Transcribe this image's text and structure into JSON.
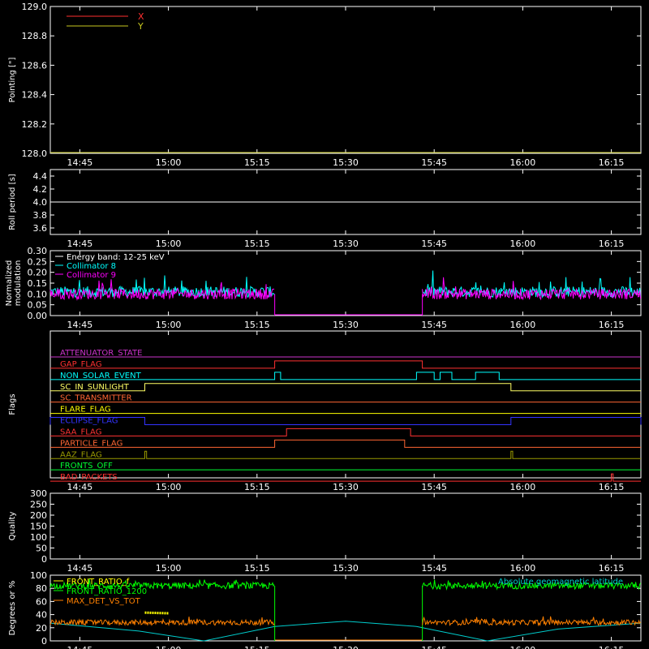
{
  "chart_data": [
    {
      "type": "line",
      "ylabel": "Pointing [\"]",
      "ylim": [
        128.0,
        129.0
      ],
      "yticks": [
        "128.0",
        "128.2",
        "128.4",
        "128.6",
        "128.8",
        "129.0"
      ],
      "xticks": [
        "14:45",
        "15:00",
        "15:15",
        "15:30",
        "15:45",
        "16:00",
        "16:15"
      ],
      "legend": [
        {
          "name": "X",
          "color": "#ff3030"
        },
        {
          "name": "Y",
          "color": "#c8c820"
        }
      ],
      "series": [
        {
          "name": "X",
          "values": []
        },
        {
          "name": "Y",
          "values": [
            {
              "x": "14:40",
              "y": 128.0
            },
            {
              "x": "16:20",
              "y": 128.0
            }
          ]
        }
      ]
    },
    {
      "type": "line",
      "ylabel": "Roll period [s]",
      "ylim": [
        3.5,
        4.5
      ],
      "yticks": [
        "3.6",
        "3.8",
        "4.0",
        "4.2",
        "4.4"
      ],
      "xticks": [
        "14:45",
        "15:00",
        "15:15",
        "15:30",
        "15:45",
        "16:00",
        "16:15"
      ],
      "series": [
        {
          "name": "roll",
          "values": [
            {
              "x": "14:40",
              "y": 4.0
            },
            {
              "x": "16:20",
              "y": 4.0
            }
          ]
        }
      ]
    },
    {
      "type": "line",
      "ylabel": "Normalized\nmodulation",
      "ylim": [
        0.0,
        0.3
      ],
      "yticks": [
        "0.00",
        "0.05",
        "0.10",
        "0.15",
        "0.20",
        "0.25",
        "0.30"
      ],
      "xticks": [
        "14:45",
        "15:00",
        "15:15",
        "15:30",
        "15:45",
        "16:00",
        "16:15"
      ],
      "legend": [
        {
          "name": "Energy band: 12-25 keV",
          "color": "#ffffff"
        },
        {
          "name": "Collimator 8",
          "color": "#00ffff"
        },
        {
          "name": "Collimator 9",
          "color": "#ff00ff"
        }
      ],
      "series": [
        {
          "name": "Collimator 8",
          "mean": 0.11,
          "segments": [
            [
              "14:40",
              "15:18"
            ],
            [
              "15:43",
              "16:20"
            ]
          ]
        },
        {
          "name": "Collimator 9",
          "mean": 0.1,
          "segments": [
            [
              "14:40",
              "15:18"
            ],
            [
              "15:43",
              "16:20"
            ]
          ]
        }
      ],
      "gap_value": 0.0,
      "gap": [
        "15:18",
        "15:43"
      ]
    },
    {
      "type": "flags",
      "ylabel": "Flags",
      "xticks": [
        "14:45",
        "15:00",
        "15:15",
        "15:30",
        "15:45",
        "16:00",
        "16:15"
      ],
      "flags": [
        {
          "name": "ATTENUATOR_STATE",
          "color": "#cc33cc",
          "on": []
        },
        {
          "name": "GAP_FLAG",
          "color": "#ff3030",
          "on": [
            [
              "15:18",
              "15:43"
            ]
          ]
        },
        {
          "name": "NON_SOLAR_EVENT",
          "color": "#00ffff",
          "on": [
            [
              "15:18",
              "15:19"
            ],
            [
              "15:42",
              "15:45"
            ],
            [
              "15:46",
              "15:48"
            ],
            [
              "15:52",
              "15:56"
            ]
          ]
        },
        {
          "name": "SC_IN_SUNLIGHT",
          "color": "#ffff66",
          "on": [
            [
              "14:56",
              "15:58"
            ]
          ]
        },
        {
          "name": "SC_TRANSMITTER",
          "color": "#ff6633",
          "on": []
        },
        {
          "name": "FLARE_FLAG",
          "color": "#ffff00",
          "on": []
        },
        {
          "name": "ECLIPSE_FLAG",
          "color": "#3333ff",
          "on": [
            [
              "14:40",
              "14:56"
            ],
            [
              "15:58",
              "16:20"
            ]
          ]
        },
        {
          "name": "SAA_FLAG",
          "color": "#ff3333",
          "on": [
            [
              "15:20",
              "15:41"
            ]
          ]
        },
        {
          "name": "PARTICLE_FLAG",
          "color": "#ff6633",
          "on": [
            [
              "15:18",
              "15:40"
            ]
          ]
        },
        {
          "name": "AAZ_FLAG",
          "color": "#999900",
          "on": [
            [
              "14:56",
              "14:56.3"
            ],
            [
              "15:58",
              "15:58.3"
            ]
          ]
        },
        {
          "name": "FRONTS_OFF",
          "color": "#00ff33",
          "on": []
        },
        {
          "name": "BAD_PACKETS",
          "color": "#ff3030",
          "on": [
            [
              "16:15",
              "16:15.3"
            ]
          ]
        }
      ]
    },
    {
      "type": "line",
      "ylabel": "Quality",
      "ylim": [
        0,
        300
      ],
      "yticks": [
        "0",
        "50",
        "100",
        "150",
        "200",
        "250",
        "300"
      ],
      "xticks": [
        "14:45",
        "15:00",
        "15:15",
        "15:30",
        "15:45",
        "16:00",
        "16:15"
      ],
      "series": []
    },
    {
      "type": "line",
      "ylabel": "Degrees or %",
      "ylim": [
        0,
        100
      ],
      "yticks": [
        "0",
        "20",
        "40",
        "60",
        "80",
        "100"
      ],
      "xticks": [
        "14:45",
        "15:00",
        "15:15",
        "15:30",
        "15:45",
        "16:00",
        "16:15"
      ],
      "legend": [
        {
          "name": "FRONT_RATIO_f",
          "color": "#ffff00"
        },
        {
          "name": "FRONT_RATIO_1200",
          "color": "#00ff00"
        },
        {
          "name": "MAX_DET_VS_TOT",
          "color": "#ff8000"
        }
      ],
      "legend_right": {
        "name": "Absolute geomagnetic latitude",
        "color": "#00cccc"
      },
      "series": [
        {
          "name": "FRONT_RATIO_1200",
          "mean": 84,
          "segments": [
            [
              "14:40",
              "15:18"
            ],
            [
              "15:43",
              "16:20"
            ]
          ],
          "gap_value": 0
        },
        {
          "name": "MAX_DET_VS_TOT",
          "mean": 28,
          "segments": [
            [
              "14:40",
              "15:18"
            ],
            [
              "15:43",
              "16:20"
            ]
          ],
          "gap_value": 0
        },
        {
          "name": "FRONT_RATIO_f",
          "values": [
            {
              "x": "14:56",
              "y": 43
            },
            {
              "x": "15:00",
              "y": 42
            }
          ]
        },
        {
          "name": "Absolute geomagnetic latitude",
          "values": [
            {
              "x": "14:40",
              "y": 27
            },
            {
              "x": "14:55",
              "y": 15
            },
            {
              "x": "15:06",
              "y": 0
            },
            {
              "x": "15:18",
              "y": 22
            },
            {
              "x": "15:30",
              "y": 30
            },
            {
              "x": "15:42",
              "y": 22
            },
            {
              "x": "15:54",
              "y": 0
            },
            {
              "x": "16:06",
              "y": 18
            },
            {
              "x": "16:20",
              "y": 27
            }
          ]
        }
      ]
    }
  ]
}
